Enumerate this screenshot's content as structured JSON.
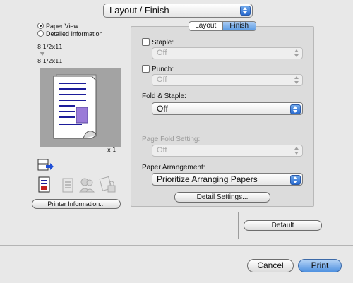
{
  "window": {
    "panel_selector": "Layout / Finish"
  },
  "left": {
    "view_options": [
      {
        "label": "Paper View",
        "selected": true
      },
      {
        "label": "Detailed Information",
        "selected": false
      }
    ],
    "paper_size_from": "8 1/2x11",
    "paper_size_to": "8 1/2x11",
    "copies": "x 1",
    "printer_info_button": "Printer Information..."
  },
  "tabs": [
    {
      "label": "Layout",
      "selected": false
    },
    {
      "label": "Finish",
      "selected": true
    }
  ],
  "finish": {
    "staple": {
      "label": "Staple:",
      "checked": false,
      "value": "Off"
    },
    "punch": {
      "label": "Punch:",
      "checked": false,
      "value": "Off"
    },
    "fold_staple": {
      "label": "Fold & Staple:",
      "value": "Off"
    },
    "page_fold": {
      "label": "Page Fold Setting:",
      "value": "Off"
    },
    "paper_arrangement": {
      "label": "Paper Arrangement:",
      "value": "Prioritize Arranging Papers"
    },
    "detail_button": "Detail Settings..."
  },
  "footer": {
    "default_button": "Default",
    "cancel_button": "Cancel",
    "print_button": "Print"
  },
  "colors": {
    "accent": "#4f91e0",
    "preview_bg": "#a3a3a3"
  }
}
